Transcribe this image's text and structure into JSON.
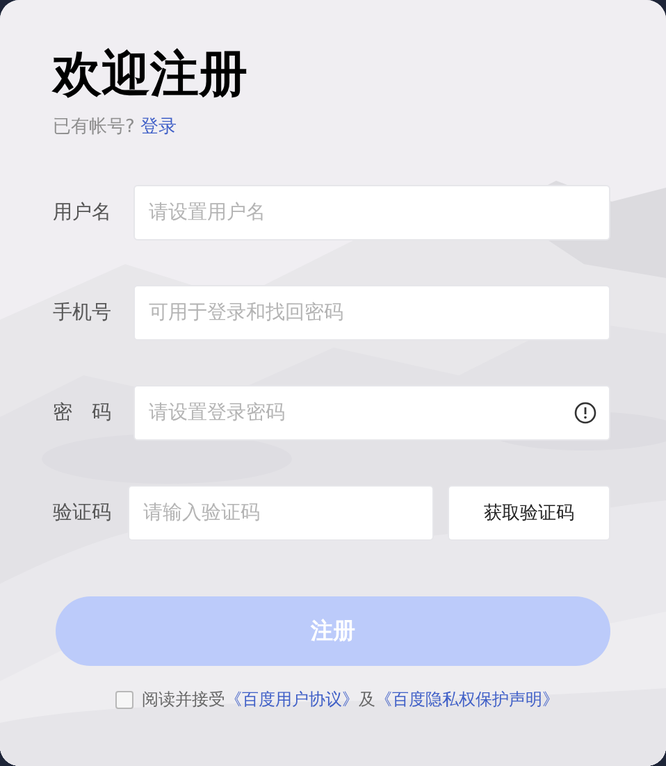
{
  "title": "欢迎注册",
  "login_prompt": {
    "text": "已有帐号?",
    "link": "登录"
  },
  "fields": [
    {
      "kind": "text",
      "label": "用户名",
      "placeholder": "请设置用户名"
    },
    {
      "kind": "text",
      "label": "手机号",
      "placeholder": "可用于登录和找回密码"
    },
    {
      "kind": "password",
      "label": "密　码",
      "placeholder": "请设置登录密码"
    },
    {
      "kind": "captcha",
      "label": "验证码",
      "placeholder": "请输入验证码",
      "button": "获取验证码"
    }
  ],
  "register_button": {
    "label": "注册",
    "disabled": true
  },
  "agreement": {
    "checked": false,
    "parts": [
      {
        "kind": "plain",
        "text": "阅读并接受"
      },
      {
        "kind": "link",
        "text": "《百度用户协议》"
      },
      {
        "kind": "plain",
        "text": "及"
      },
      {
        "kind": "link",
        "text": "《百度隐私权保护声明》"
      }
    ]
  }
}
